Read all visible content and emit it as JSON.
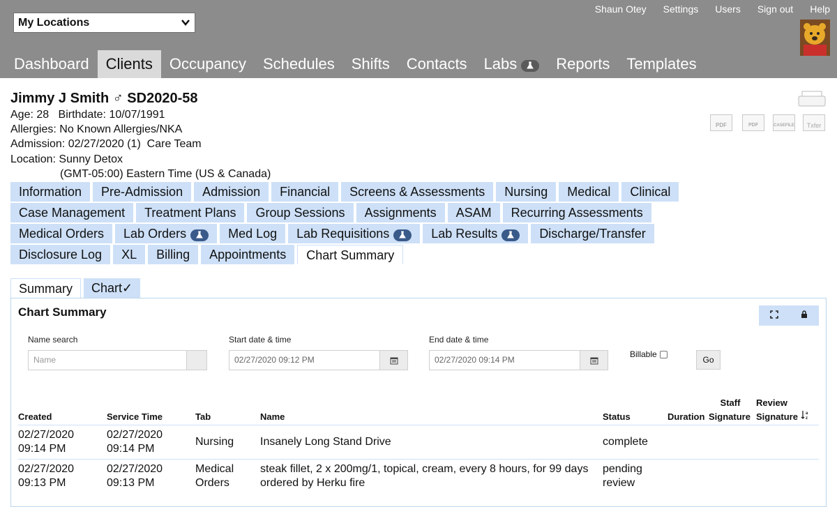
{
  "topbar": {
    "location_select": "My Locations",
    "user_links": [
      "Shaun Otey",
      "Settings",
      "Users",
      "Sign out",
      "Help"
    ],
    "nav": [
      {
        "label": "Dashboard",
        "active": false
      },
      {
        "label": "Clients",
        "active": true
      },
      {
        "label": "Occupancy",
        "active": false
      },
      {
        "label": "Schedules",
        "active": false
      },
      {
        "label": "Shifts",
        "active": false
      },
      {
        "label": "Contacts",
        "active": false
      },
      {
        "label": "Labs",
        "active": false,
        "badge": "flask-icon"
      },
      {
        "label": "Reports",
        "active": false
      },
      {
        "label": "Templates",
        "active": false
      }
    ]
  },
  "patient": {
    "name": "Jimmy J Smith",
    "gender_symbol": "♂",
    "id": "SD2020-58",
    "age_label": "Age:",
    "age": "28",
    "birthdate_label": "Birthdate:",
    "birthdate": "10/07/1991",
    "allergies_label": "Allergies:",
    "allergies": "No Known Allergies/NKA",
    "admission_label": "Admission:",
    "admission": "02/27/2020 (1)",
    "care_team": "Care Team",
    "location_label": "Location:",
    "location": "Sunny Detox",
    "timezone": "(GMT-05:00) Eastern Time (US & Canada)"
  },
  "doc_icons": [
    "PDF",
    "PDF",
    "CASEFILE",
    "Txfer"
  ],
  "tabs": {
    "row1": [
      "Information",
      "Pre-Admission",
      "Admission",
      "Financial",
      "Screens & Assessments",
      "Nursing",
      "Medical",
      "Clinical"
    ],
    "row2": [
      "Case Management",
      "Treatment Plans",
      "Group Sessions",
      "Assignments",
      "ASAM",
      "Recurring Assessments"
    ],
    "row3": [
      "Medical Orders",
      "Lab Orders",
      "Med Log",
      "Lab Requisitions",
      "Lab Results",
      "Discharge/Transfer"
    ],
    "row4": [
      "Disclosure Log",
      "XL",
      "Billing",
      "Appointments",
      "Chart Summary"
    ],
    "active": "Chart Summary"
  },
  "subtabs": [
    "Summary",
    "Chart✓"
  ],
  "panel": {
    "title": "Chart Summary",
    "name_search_label": "Name search",
    "name_search_placeholder": "Name",
    "start_label": "Start date & time",
    "start_value": "02/27/2020 09:12 PM",
    "end_label": "End date & time",
    "end_value": "02/27/2020 09:14 PM",
    "billable_label": "Billable",
    "go_label": "Go"
  },
  "table": {
    "headers": {
      "created": "Created",
      "service_time": "Service Time",
      "tab": "Tab",
      "name": "Name",
      "status": "Status",
      "duration": "Duration",
      "staff_signature_1": "Staff",
      "staff_signature_2": "Signature",
      "review_signature_1": "Review",
      "review_signature_2": "Signature"
    },
    "rows": [
      {
        "created_date": "02/27/2020",
        "created_time": "09:14 PM",
        "service_date": "02/27/2020",
        "service_time": "09:14 PM",
        "tab": "Nursing",
        "tab_2": "",
        "name": "Insanely Long Stand Drive",
        "name_2": "",
        "status": "complete",
        "status_2": ""
      },
      {
        "created_date": "02/27/2020",
        "created_time": "09:13 PM",
        "service_date": "02/27/2020",
        "service_time": "09:13 PM",
        "tab": "Medical",
        "tab_2": "Orders",
        "name": "steak fillet, 2 x 200mg/1, topical, cream, every 8 hours, for 99 days",
        "name_2": "ordered by Herku fire",
        "status": "pending",
        "status_2": "review"
      }
    ]
  }
}
